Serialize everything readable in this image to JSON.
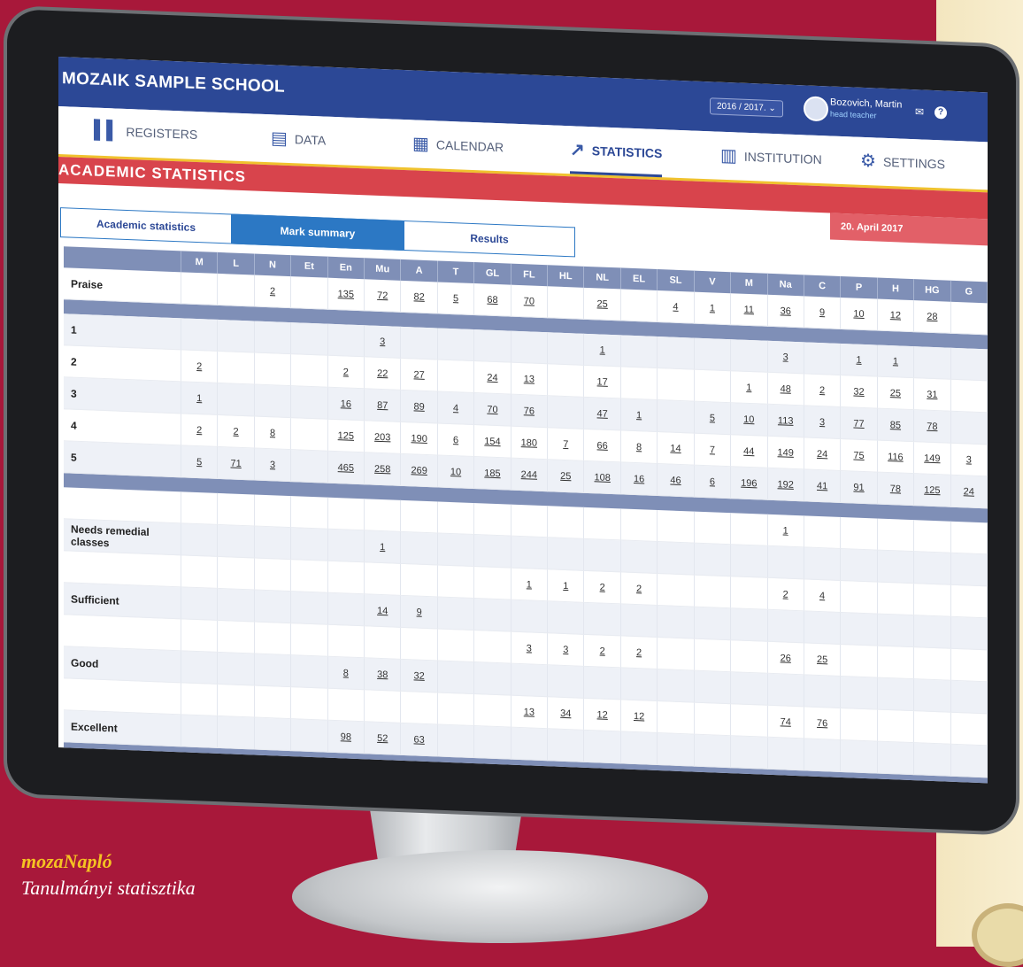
{
  "caption": {
    "brand": "mozaNapló",
    "subtitle": "Tanulmányi statisztika"
  },
  "app": {
    "school": "MOZAIK SAMPLE SCHOOL",
    "year": "2016 / 2017. ⌄",
    "user_name": "Bozovich, Martin",
    "user_role": "head teacher",
    "mail_icon": "✉",
    "help_icon": "?"
  },
  "nav": [
    {
      "label": "REGISTERS",
      "icon": "▌▌"
    },
    {
      "label": "DATA",
      "icon": "▤"
    },
    {
      "label": "CALENDAR",
      "icon": "▦"
    },
    {
      "label": "STATISTICS",
      "icon": "↗"
    },
    {
      "label": "INSTITUTION",
      "icon": "▥"
    },
    {
      "label": "SETTINGS",
      "icon": "⚙"
    }
  ],
  "page_title": "ACADEMIC STATISTICS",
  "date": "20. April 2017",
  "tabs": [
    "Academic statistics",
    "Mark summary",
    "Results"
  ],
  "columns": [
    "",
    "M",
    "L",
    "N",
    "Et",
    "En",
    "Mu",
    "A",
    "T",
    "GL",
    "FL",
    "HL",
    "NL",
    "EL",
    "SL",
    "V",
    "M",
    "Na",
    "C",
    "P",
    "H",
    "HG",
    "G"
  ],
  "rows": [
    {
      "label": "Praise",
      "cells": [
        "",
        "",
        "2",
        "",
        "135",
        "72",
        "82",
        "5",
        "68",
        "70",
        "",
        "25",
        "",
        "4",
        "1",
        "11",
        "36",
        "9",
        "10",
        "12",
        "28",
        ""
      ]
    },
    {
      "sep": true
    },
    {
      "label": "1",
      "cells": [
        "",
        "",
        "",
        "",
        "",
        "3",
        "",
        "",
        "",
        "",
        "",
        "1",
        "",
        "",
        "",
        "",
        "3",
        "",
        "1",
        "1",
        "",
        ""
      ]
    },
    {
      "label": "2",
      "cells": [
        "2",
        "",
        "",
        "",
        "2",
        "22",
        "27",
        "",
        "24",
        "13",
        "",
        "17",
        "",
        "",
        "",
        "1",
        "48",
        "2",
        "32",
        "25",
        "31",
        ""
      ]
    },
    {
      "label": "3",
      "cells": [
        "1",
        "",
        "",
        "",
        "16",
        "87",
        "89",
        "4",
        "70",
        "76",
        "",
        "47",
        "1",
        "",
        "5",
        "10",
        "113",
        "3",
        "77",
        "85",
        "78",
        ""
      ]
    },
    {
      "label": "4",
      "cells": [
        "2",
        "2",
        "8",
        "",
        "125",
        "203",
        "190",
        "6",
        "154",
        "180",
        "7",
        "66",
        "8",
        "14",
        "7",
        "44",
        "149",
        "24",
        "75",
        "116",
        "149",
        "3"
      ]
    },
    {
      "label": "5",
      "cells": [
        "5",
        "71",
        "3",
        "",
        "465",
        "258",
        "269",
        "10",
        "185",
        "244",
        "25",
        "108",
        "16",
        "46",
        "6",
        "196",
        "192",
        "41",
        "91",
        "78",
        "125",
        "24"
      ]
    },
    {
      "sep": true
    },
    {
      "label": "",
      "cells": [
        "",
        "",
        "",
        "",
        "",
        "",
        "",
        "",
        "",
        "",
        "",
        "",
        "",
        "",
        "",
        "",
        "1",
        "",
        "",
        "",
        "",
        ""
      ]
    },
    {
      "label": "Needs remedial classes",
      "cells": [
        "",
        "",
        "",
        "",
        "",
        "1",
        "",
        "",
        "",
        "",
        "",
        "",
        "",
        "",
        "",
        "",
        "",
        "",
        "",
        "",
        "",
        ""
      ]
    },
    {
      "label": "",
      "cells": [
        "",
        "",
        "",
        "",
        "",
        "",
        "",
        "",
        "",
        "1",
        "1",
        "2",
        "2",
        "",
        "",
        "",
        "2",
        "4",
        "",
        "",
        "",
        ""
      ]
    },
    {
      "label": "Sufficient",
      "cells": [
        "",
        "",
        "",
        "",
        "",
        "14",
        "9",
        "",
        "",
        "",
        "",
        "",
        "",
        "",
        "",
        "",
        "",
        "",
        "",
        "",
        "",
        ""
      ]
    },
    {
      "label": "",
      "cells": [
        "",
        "",
        "",
        "",
        "",
        "",
        "",
        "",
        "",
        "3",
        "3",
        "2",
        "2",
        "",
        "",
        "",
        "26",
        "25",
        "",
        "",
        "",
        ""
      ]
    },
    {
      "label": "Good",
      "cells": [
        "",
        "",
        "",
        "",
        "8",
        "38",
        "32",
        "",
        "",
        "",
        "",
        "",
        "",
        "",
        "",
        "",
        "",
        "",
        "",
        "",
        "",
        ""
      ]
    },
    {
      "label": "",
      "cells": [
        "",
        "",
        "",
        "",
        "",
        "",
        "",
        "",
        "",
        "13",
        "34",
        "12",
        "12",
        "",
        "",
        "",
        "74",
        "76",
        "",
        "",
        "",
        ""
      ]
    },
    {
      "label": "Excellent",
      "cells": [
        "",
        "",
        "",
        "",
        "98",
        "52",
        "63",
        "",
        "",
        "",
        "",
        "",
        "",
        "",
        "",
        "",
        "",
        "",
        "",
        "",
        "",
        ""
      ]
    },
    {
      "sep": true
    }
  ]
}
